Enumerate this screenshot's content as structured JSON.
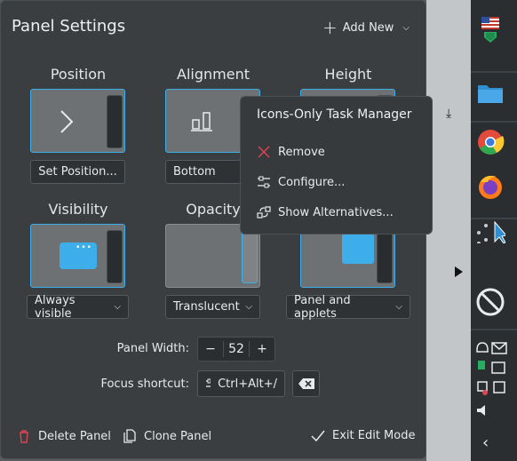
{
  "panel": {
    "title": "Panel Settings",
    "add_new_label": "Add New"
  },
  "sections": {
    "position": {
      "label": "Position",
      "button": "Set Position..."
    },
    "alignment": {
      "label": "Alignment",
      "button": "Bottom"
    },
    "height": {
      "label": "Height"
    },
    "visibility": {
      "label": "Visibility",
      "button": "Always visible"
    },
    "opacity": {
      "label": "Opacity",
      "button": "Translucent"
    },
    "floating": {
      "button": "Panel and applets"
    }
  },
  "width_row": {
    "label": "Panel Width:",
    "value": "52"
  },
  "shortcut_row": {
    "label": "Focus shortcut:",
    "value": "Ctrl+Alt+/"
  },
  "footer": {
    "delete_label": "Delete Panel",
    "clone_label": "Clone Panel",
    "exit_label": "Exit Edit Mode"
  },
  "popup": {
    "title": "Icons-Only Task Manager",
    "items": [
      "Remove",
      "Configure...",
      "Show Alternatives..."
    ]
  },
  "colors": {
    "accent": "#3daee9",
    "panel_bg": "#3a3e41",
    "danger": "#da4453"
  },
  "dock": {
    "icons": [
      "us-flag-icon",
      "shield-icon",
      "folder-icon",
      "chrome-icon",
      "firefox-icon",
      "cursor-icon",
      "no-entry-icon",
      "bell-icon",
      "mail-icon",
      "clipboard-icon",
      "volume-icon",
      "chevron-left-icon"
    ]
  }
}
